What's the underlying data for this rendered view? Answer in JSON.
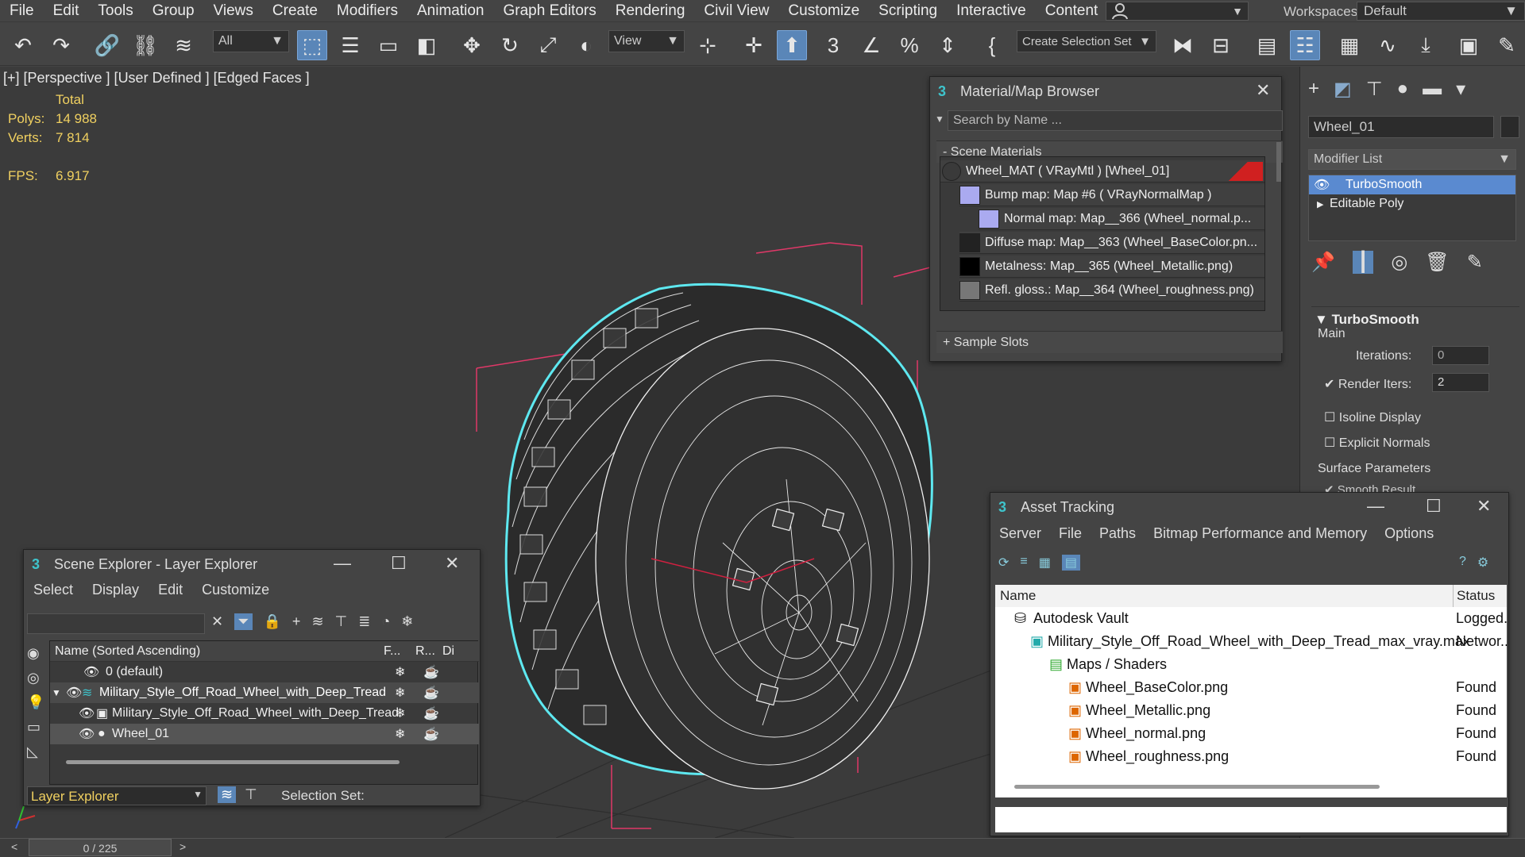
{
  "menubar": {
    "items": [
      "File",
      "Edit",
      "Tools",
      "Group",
      "Views",
      "Create",
      "Modifiers",
      "Animation",
      "Graph Editors",
      "Rendering",
      "Civil View",
      "Customize",
      "Scripting",
      "Interactive",
      "Content"
    ],
    "more": "»",
    "workspaces_label": "Workspaces:",
    "workspace_value": "Default"
  },
  "toolbar": {
    "filter_value": "All",
    "view_value": "View",
    "selection_set_label": "Create Selection Set",
    "icons": [
      "undo-icon",
      "redo-icon",
      "link-icon",
      "unlink-icon",
      "bind-space-warp-icon",
      "select-icon",
      "select-by-name-icon",
      "rect-region-icon",
      "window-crossing-icon",
      "move-icon",
      "rotate-icon",
      "scale-icon",
      "placement-icon",
      "pivot-icon",
      "select-manipulate-icon",
      "keyboard-shortcut-icon",
      "snap-icon",
      "angle-snap-icon",
      "percent-snap-icon",
      "spinner-snap-icon",
      "edit-named-sets-icon",
      "mirror-icon",
      "align-icon",
      "scene-explorer-icon",
      "layer-explorer-icon",
      "ribbon-icon",
      "curve-editor-icon",
      "schematic-icon",
      "material-editor-icon",
      "render-setup-icon"
    ]
  },
  "viewport": {
    "label": "[+] [Perspective ] [User Defined ] [Edged Faces ]",
    "stats": {
      "total_label": "Total",
      "polys_label": "Polys:",
      "polys_value": "14 988",
      "verts_label": "Verts:",
      "verts_value": "7 814",
      "fps_label": "FPS:",
      "fps_value": "6.917"
    },
    "colors": {
      "wire": "#ffffff",
      "selection": "#5ee8f0",
      "bbox": "#e03868",
      "background": "#3b3b3b"
    }
  },
  "material_browser": {
    "title": "Material/Map Browser",
    "search_placeholder": "Search by Name ...",
    "scene_materials_label": "- Scene Materials",
    "sample_slots_label": "+ Sample Slots",
    "items": [
      {
        "label": "Wheel_MAT  ( VRayMtl )  [Wheel_01]"
      },
      {
        "label": "Bump map: Map #6  ( VRayNormalMap )"
      },
      {
        "label": "Normal map: Map__366 (Wheel_normal.p..."
      },
      {
        "label": "Diffuse map: Map__363 (Wheel_BaseColor.pn..."
      },
      {
        "label": "Metalness: Map__365 (Wheel_Metallic.png)"
      },
      {
        "label": "Refl. gloss.: Map__364 (Wheel_roughness.png)"
      }
    ]
  },
  "command_panel": {
    "object_name": "Wheel_01",
    "modifier_list_label": "Modifier List",
    "stack": [
      "TurboSmooth",
      "Editable Poly"
    ],
    "rollout_title": "TurboSmooth",
    "main_label": "Main",
    "iterations_label": "Iterations:",
    "iterations_value": "0",
    "render_iters_label": "Render Iters:",
    "render_iters_value": "2",
    "isoline_label": "Isoline Display",
    "explicit_normals_label": "Explicit Normals",
    "surface_params_label": "Surface Parameters",
    "smooth_result_label": "Smooth Result"
  },
  "asset_tracking": {
    "title": "Asset Tracking",
    "menu": [
      "Server",
      "File",
      "Paths",
      "Bitmap Performance and Memory",
      "Options"
    ],
    "col_name": "Name",
    "col_status": "Status",
    "rows": [
      {
        "name": "Autodesk Vault",
        "status": "Logged."
      },
      {
        "name": "Military_Style_Off_Road_Wheel_with_Deep_Tread_max_vray.max",
        "status": "Networ.."
      },
      {
        "name": "Maps / Shaders",
        "status": ""
      },
      {
        "name": "Wheel_BaseColor.png",
        "status": "Found"
      },
      {
        "name": "Wheel_Metallic.png",
        "status": "Found"
      },
      {
        "name": "Wheel_normal.png",
        "status": "Found"
      },
      {
        "name": "Wheel_roughness.png",
        "status": "Found"
      }
    ]
  },
  "scene_explorer": {
    "title": "Scene Explorer - Layer Explorer",
    "menu": [
      "Select",
      "Display",
      "Edit",
      "Customize"
    ],
    "col_name": "Name (Sorted Ascending)",
    "col_f": "F...",
    "col_r": "R...",
    "col_d": "Di",
    "rows": [
      {
        "name": "0 (default)"
      },
      {
        "name": "Military_Style_Off_Road_Wheel_with_Deep_Tread"
      },
      {
        "name": "Military_Style_Off_Road_Wheel_with_Deep_Tread"
      },
      {
        "name": "Wheel_01"
      }
    ],
    "footer_explorer": "Layer Explorer",
    "footer_selection": "Selection Set:"
  },
  "timeline": {
    "frame": "0 / 225",
    "prev": "<",
    "next": ">"
  }
}
